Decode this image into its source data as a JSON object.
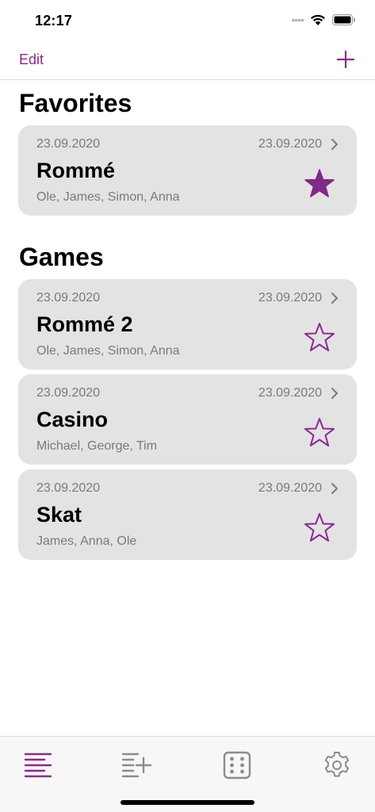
{
  "status_bar": {
    "time": "12:17"
  },
  "nav": {
    "edit_label": "Edit",
    "add_icon": "plus-icon"
  },
  "colors": {
    "accent": "#8a2a8f",
    "card_bg": "#e3e3e3",
    "secondary_text": "#7a7a7a"
  },
  "favorites": {
    "title": "Favorites",
    "items": [
      {
        "date_start": "23.09.2020",
        "date_end": "23.09.2020",
        "name": "Rommé",
        "players": "Ole, James, Simon, Anna",
        "favorite": true
      }
    ]
  },
  "games": {
    "title": "Games",
    "items": [
      {
        "date_start": "23.09.2020",
        "date_end": "23.09.2020",
        "name": "Rommé 2",
        "players": "Ole, James, Simon, Anna",
        "favorite": false
      },
      {
        "date_start": "23.09.2020",
        "date_end": "23.09.2020",
        "name": "Casino",
        "players": "Michael, George, Tim",
        "favorite": false
      },
      {
        "date_start": "23.09.2020",
        "date_end": "23.09.2020",
        "name": "Skat",
        "players": "James, Anna, Ole",
        "favorite": false
      }
    ]
  },
  "tab_bar": {
    "tabs": [
      {
        "icon": "list-icon",
        "selected": true
      },
      {
        "icon": "list-add-icon",
        "selected": false
      },
      {
        "icon": "dice-icon",
        "selected": false
      },
      {
        "icon": "gear-icon",
        "selected": false
      }
    ]
  }
}
